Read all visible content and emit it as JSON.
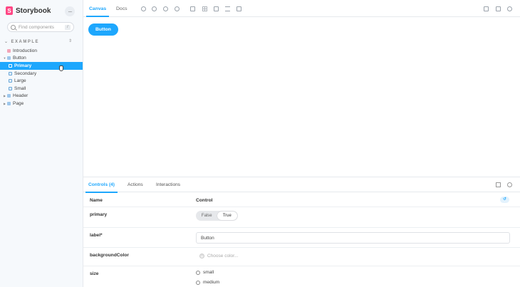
{
  "sidebar": {
    "brand": "Storybook",
    "brand_logo_letter": "S",
    "menu_label": "···",
    "search": {
      "placeholder": "Find components",
      "shortcut": "/"
    },
    "section": "EXAMPLE",
    "items": [
      {
        "label": "Introduction",
        "level": 0,
        "type": "doc"
      },
      {
        "label": "Button",
        "level": 0,
        "type": "component"
      },
      {
        "label": "Primary",
        "level": 1,
        "type": "story",
        "selected": true
      },
      {
        "label": "Secondary",
        "level": 1,
        "type": "story"
      },
      {
        "label": "Large",
        "level": 1,
        "type": "story"
      },
      {
        "label": "Small",
        "level": 1,
        "type": "story"
      },
      {
        "label": "Header",
        "level": 0,
        "type": "component"
      },
      {
        "label": "Page",
        "level": 0,
        "type": "component"
      }
    ]
  },
  "toolbar": {
    "tabs": [
      "Canvas",
      "Docs"
    ],
    "active_tab": "Canvas",
    "icons": [
      "reload-icon",
      "zoom-in-icon",
      "zoom-out-icon",
      "zoom-reset-icon",
      "background-icon",
      "grid-icon",
      "viewport-icon",
      "measure-icon",
      "outline-icon",
      "fullscreen-icon",
      "open-new-tab-icon",
      "copy-link-icon"
    ]
  },
  "canvas": {
    "button_label": "Button"
  },
  "panel": {
    "tabs": [
      "Controls (4)",
      "Actions",
      "Interactions"
    ],
    "active_tab": "Controls (4)",
    "headers": {
      "name": "Name",
      "control": "Control"
    },
    "controls": {
      "primary": {
        "label": "primary",
        "options": [
          "False",
          "True"
        ],
        "value": "True"
      },
      "label": {
        "label": "label*",
        "value": "Button"
      },
      "backgroundColor": {
        "label": "backgroundColor",
        "placeholder": "Choose color..."
      },
      "size": {
        "label": "size",
        "options": [
          "small",
          "medium"
        ]
      }
    }
  },
  "colors": {
    "accent": "#1ea7fd",
    "brand": "#ff4785",
    "sidebar_bg": "#f6f9fc"
  }
}
